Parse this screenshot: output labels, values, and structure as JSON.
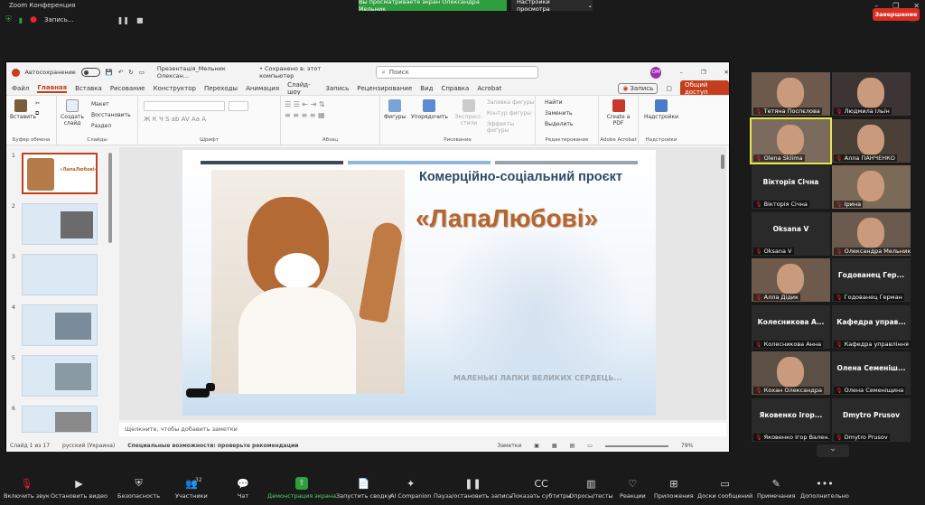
{
  "window": {
    "title": "Zoom Конференция"
  },
  "share_notice": "Вы просматриваете экран Олександра Мельник",
  "view_options": "Настройки просмотра",
  "zoom_top": {
    "record_label": "Запись..."
  },
  "ppt": {
    "autosave_label": "Автосохранение",
    "doc_title": "Презентація_Мельник Олексан...",
    "save_state": "• Сохранено в: этот компьютер",
    "search_placeholder": "Поиск",
    "avatar": "ОМ",
    "menu": [
      "Файл",
      "Главная",
      "Вставка",
      "Рисование",
      "Конструктор",
      "Переходы",
      "Анимация",
      "Слайд-шоу",
      "Запись",
      "Рецензирование",
      "Вид",
      "Справка",
      "Acrobat"
    ],
    "record_btn": "Запись",
    "share_btn": "Общий доступ",
    "ribbon": {
      "paste": "Вставить",
      "clipboard": "Буфер обмена",
      "create_slide": "Создать слайд",
      "layout": "Макет",
      "reset": "Восстановить",
      "section": "Раздел",
      "slides": "Слайды",
      "font": "Шрифт",
      "paragraph": "Абзац",
      "shapes": "Фигуры",
      "arrange": "Упорядочить",
      "quick_styles": "Экспресс-стили",
      "fill": "Заливка фигуры",
      "outline": "Контур фигуры",
      "effects": "Эффекты фигуры",
      "drawing": "Рисование",
      "find": "Найти",
      "replace": "Заменить",
      "select": "Выделить",
      "editing": "Редактирование",
      "create_pdf": "Create a PDF",
      "adobe": "Adobe Acrobat",
      "addins_btn": "Надстройки",
      "addins": "Надстройки"
    },
    "thumb_numbers": [
      "1",
      "2",
      "3",
      "4",
      "5",
      "6"
    ],
    "slide": {
      "subtitle": "Комерційно-соціальний проєкт",
      "title": "«ЛапаЛюбові»",
      "footer": "МАЛЕНЬКІ ЛАПКИ ВЕЛИКИХ СЕРДЕЦЬ..."
    },
    "thumb1_title": "«ЛапаЛюбові»",
    "notes_placeholder": "Щелкните, чтобы добавить заметки",
    "status": {
      "slide": "Слайд 1 из 17",
      "lang": "русский (Украина)",
      "accessibility": "Специальные возможности: проверьте рекомендации",
      "notes": "Заметки",
      "zoom": "79%"
    }
  },
  "participants": [
    {
      "name": "Тетяна Поспєлова",
      "video": true
    },
    {
      "name": "Людмила Ільїн",
      "video": true
    },
    {
      "name": "Olena Sklima",
      "video": true,
      "active": true
    },
    {
      "name": "Алла ПАНЧЕНКО",
      "video": true
    },
    {
      "name": "Вікторія Січна",
      "big": "Вікторія Січна",
      "video": false
    },
    {
      "name": "Ірина",
      "video": true
    },
    {
      "name": "Oksana V",
      "big": "Oksana V",
      "video": false
    },
    {
      "name": "Олександра Мельник",
      "video": true
    },
    {
      "name": "Алла Дідик",
      "video": true
    },
    {
      "name": "Годованец Герман",
      "big": "Годованец Гер...",
      "video": false
    },
    {
      "name": "Колесникова Анна",
      "big": "Колесникова А...",
      "video": false
    },
    {
      "name": "Кафедра управління",
      "big": "Кафедра управ...",
      "video": false
    },
    {
      "name": "Кохан Олександра",
      "video": true
    },
    {
      "name": "Олена Семеніщина",
      "big": "Олена Семеніш...",
      "video": false
    },
    {
      "name": "Яковенко Ігор Вален...",
      "big": "Яковенко Ігор...",
      "video": false
    },
    {
      "name": "Dmytro Prusov",
      "big": "Dmytro Prusov",
      "video": false
    }
  ],
  "toolbar": [
    {
      "label": "Включить звук",
      "icon": "mic-off-icon"
    },
    {
      "label": "Остановить видео",
      "icon": "video-icon"
    },
    {
      "label": "Безопасность",
      "icon": "shield-icon"
    },
    {
      "label": "Участники",
      "icon": "participants-icon",
      "count": "32"
    },
    {
      "label": "Чат",
      "icon": "chat-icon"
    },
    {
      "label": "Демонстрация экрана",
      "icon": "share-icon"
    },
    {
      "label": "Запустить сводку",
      "icon": "summary-icon"
    },
    {
      "label": "AI Companion",
      "icon": "ai-icon"
    },
    {
      "label": "Пауза/остановить запись",
      "icon": "pause-icon"
    },
    {
      "label": "Показать субтитры",
      "icon": "cc-icon"
    },
    {
      "label": "Опросы/тесты",
      "icon": "poll-icon"
    },
    {
      "label": "Реакции",
      "icon": "heart-icon"
    },
    {
      "label": "Приложения",
      "icon": "apps-icon"
    },
    {
      "label": "Доски сообщений",
      "icon": "board-icon"
    },
    {
      "label": "Примечания",
      "icon": "notes-icon"
    },
    {
      "label": "Дополнительно",
      "icon": "more-icon"
    }
  ],
  "end_label": "Завершение",
  "colors": {
    "share_green": "#2e9e3f",
    "ppt_accent": "#c43e1c",
    "end_red": "#d92d20",
    "title_orange": "#b8652a",
    "subtitle_navy": "#2f4a66"
  }
}
